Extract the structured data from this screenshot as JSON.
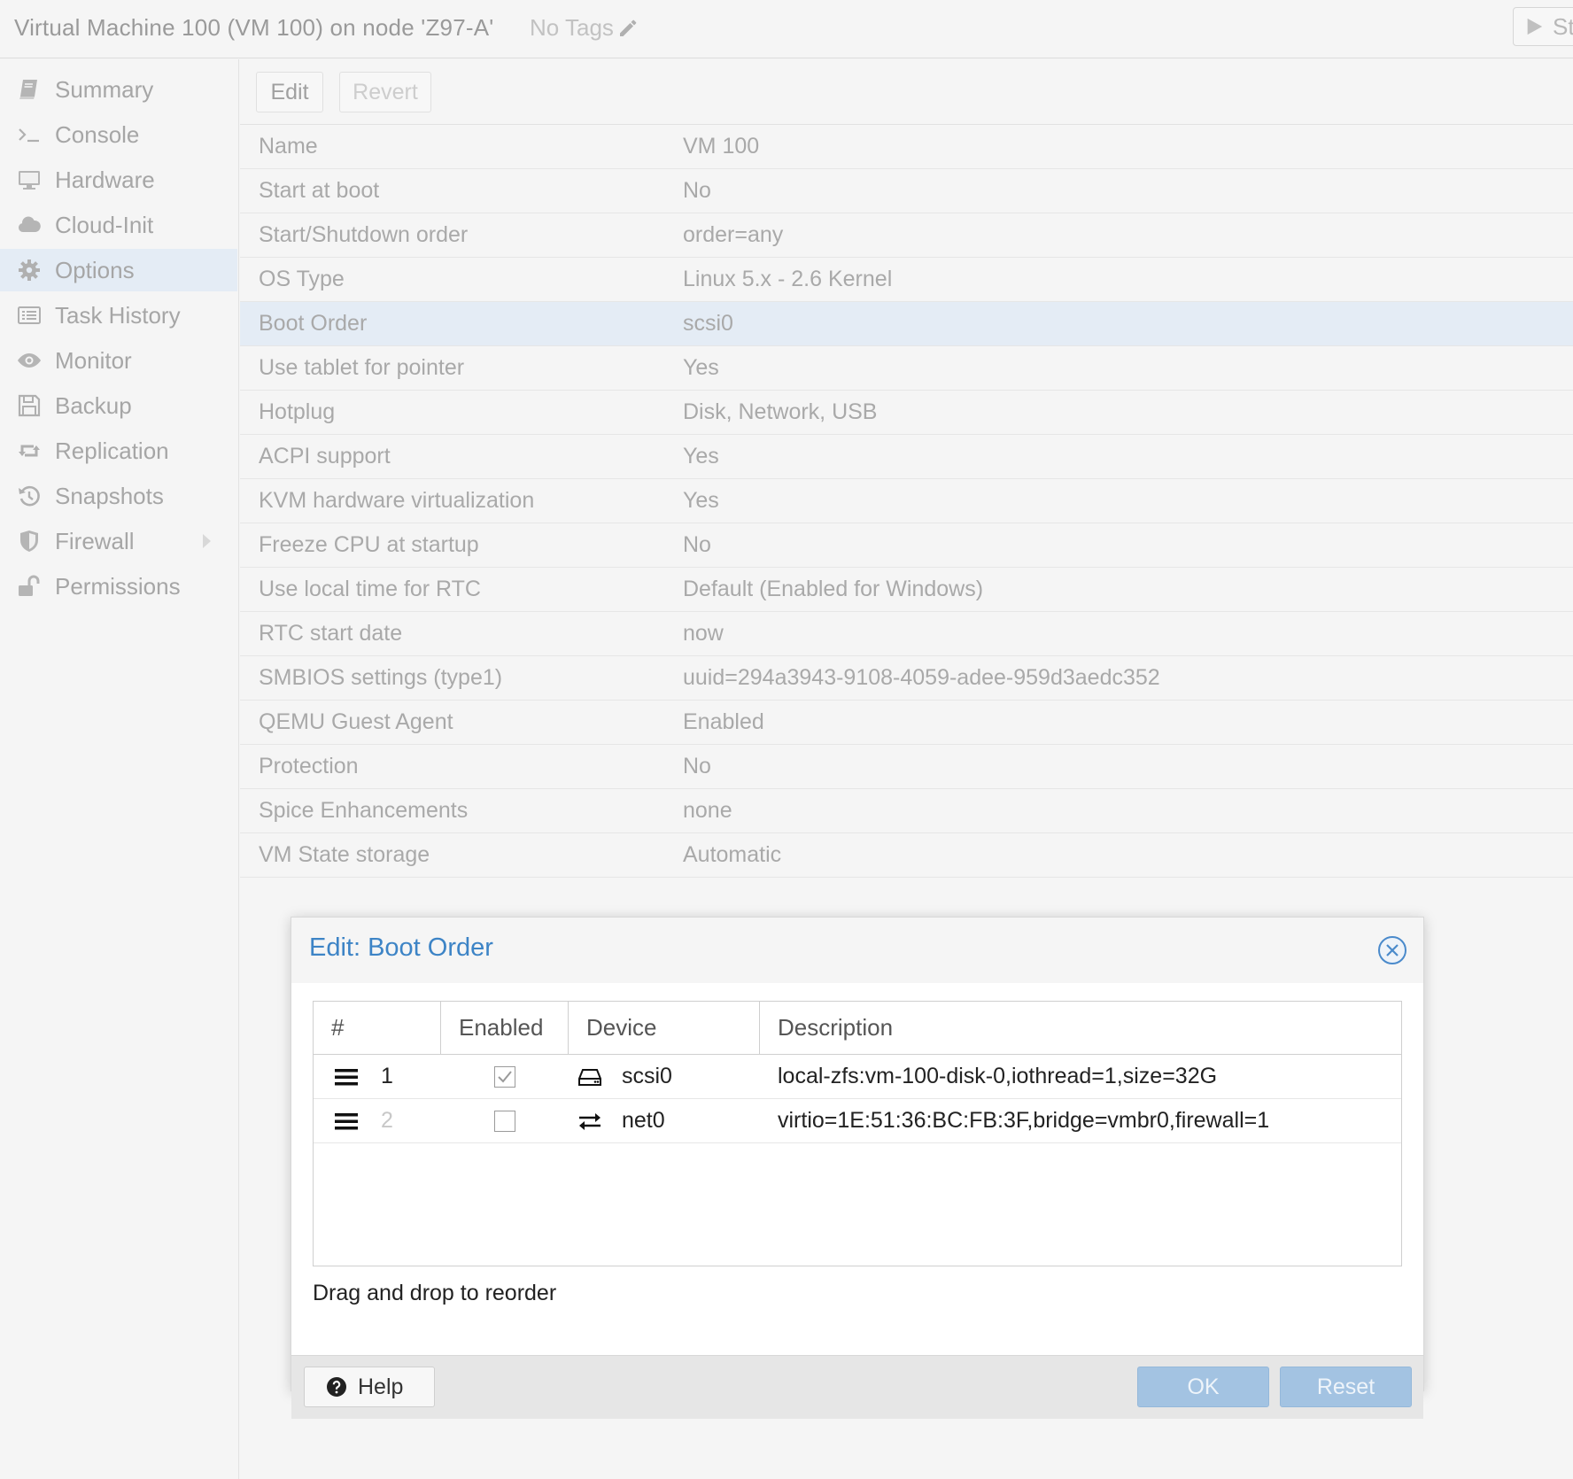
{
  "header": {
    "title": "Virtual Machine 100 (VM 100) on node 'Z97-A'",
    "tags_label": "No Tags",
    "start_label": "Start"
  },
  "sidebar": {
    "items": [
      {
        "label": "Summary",
        "icon": "book-icon"
      },
      {
        "label": "Console",
        "icon": "terminal-icon"
      },
      {
        "label": "Hardware",
        "icon": "desktop-icon"
      },
      {
        "label": "Cloud-Init",
        "icon": "cloud-icon"
      },
      {
        "label": "Options",
        "icon": "gear-icon",
        "active": true
      },
      {
        "label": "Task History",
        "icon": "list-icon"
      },
      {
        "label": "Monitor",
        "icon": "eye-icon"
      },
      {
        "label": "Backup",
        "icon": "floppy-icon"
      },
      {
        "label": "Replication",
        "icon": "retweet-icon"
      },
      {
        "label": "Snapshots",
        "icon": "history-icon"
      },
      {
        "label": "Firewall",
        "icon": "shield-icon"
      },
      {
        "label": "Permissions",
        "icon": "unlock-icon"
      }
    ]
  },
  "toolbar": {
    "edit_label": "Edit",
    "revert_label": "Revert"
  },
  "options": [
    {
      "key": "Name",
      "value": "VM 100"
    },
    {
      "key": "Start at boot",
      "value": "No"
    },
    {
      "key": "Start/Shutdown order",
      "value": "order=any"
    },
    {
      "key": "OS Type",
      "value": "Linux 5.x - 2.6 Kernel"
    },
    {
      "key": "Boot Order",
      "value": "scsi0",
      "selected": true
    },
    {
      "key": "Use tablet for pointer",
      "value": "Yes"
    },
    {
      "key": "Hotplug",
      "value": "Disk, Network, USB"
    },
    {
      "key": "ACPI support",
      "value": "Yes"
    },
    {
      "key": "KVM hardware virtualization",
      "value": "Yes"
    },
    {
      "key": "Freeze CPU at startup",
      "value": "No"
    },
    {
      "key": "Use local time for RTC",
      "value": "Default (Enabled for Windows)"
    },
    {
      "key": "RTC start date",
      "value": "now"
    },
    {
      "key": "SMBIOS settings (type1)",
      "value": "uuid=294a3943-9108-4059-adee-959d3aedc352"
    },
    {
      "key": "QEMU Guest Agent",
      "value": "Enabled"
    },
    {
      "key": "Protection",
      "value": "No"
    },
    {
      "key": "Spice Enhancements",
      "value": "none"
    },
    {
      "key": "VM State storage",
      "value": "Automatic"
    }
  ],
  "modal": {
    "title": "Edit: Boot Order",
    "columns": {
      "num": "#",
      "enabled": "Enabled",
      "device": "Device",
      "description": "Description"
    },
    "rows": [
      {
        "num": "1",
        "enabled": true,
        "device": "scsi0",
        "device_icon": "hdd-icon",
        "description": "local-zfs:vm-100-disk-0,iothread=1,size=32G"
      },
      {
        "num": "2",
        "enabled": false,
        "device": "net0",
        "device_icon": "exchange-icon",
        "description": "virtio=1E:51:36:BC:FB:3F,bridge=vmbr0,firewall=1"
      }
    ],
    "hint": "Drag and drop to reorder",
    "help_label": "Help",
    "ok_label": "OK",
    "reset_label": "Reset"
  },
  "colors": {
    "accent": "#3d84c6",
    "selected_row": "#e4ecf5",
    "primary_button_disabled": "#a3c3e2"
  }
}
